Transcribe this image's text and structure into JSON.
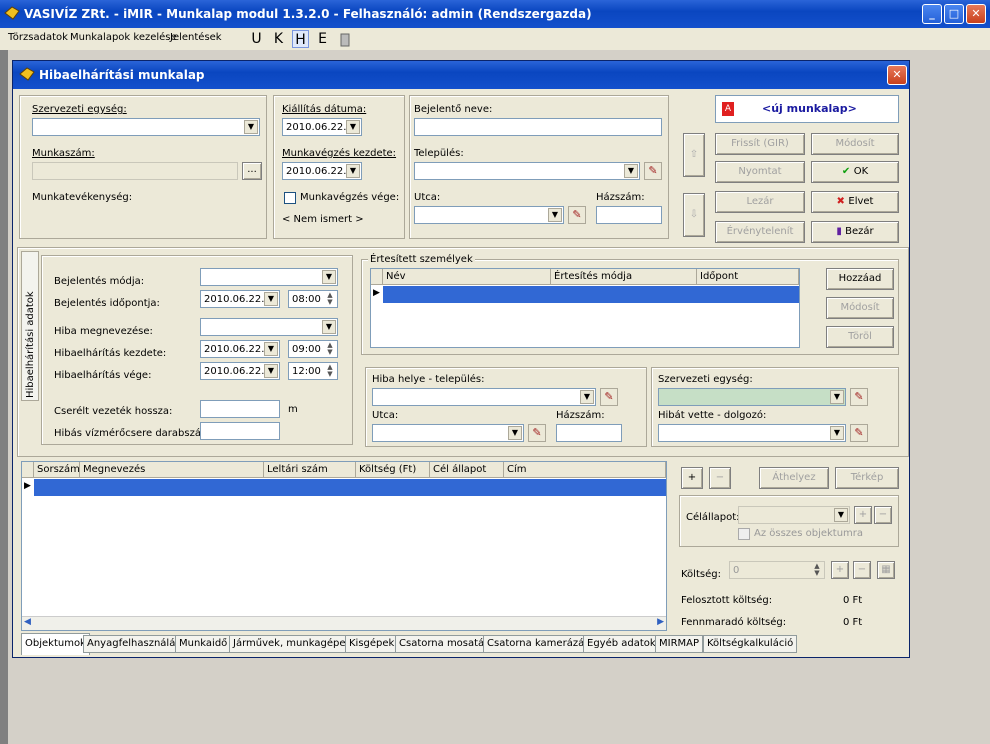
{
  "app": {
    "title": "VASIVÍZ ZRt. - iMIR - Munkalap modul 1.3.2.0 - Felhasználó: admin (Rendszergazda)",
    "min": "_",
    "max": "□",
    "close": "✕"
  },
  "menu": {
    "items": [
      "Törzsadatok",
      "Munkalapok kezelése",
      "Jelentések"
    ],
    "ukhe": [
      "U",
      "K",
      "H",
      "E"
    ]
  },
  "window": {
    "title": "Hibaelhárítási munkalap",
    "close": "✕"
  },
  "top": {
    "szervezeti_egyseg_label": "Szervezeti egység:",
    "munkaszam_label": "Munkaszám:",
    "browse": "...",
    "munkatevekenyseg_label": "Munkatevékenység:",
    "kiallitas_label": "Kiállítás dátuma:",
    "kiallitas_value": "2010.06.22.",
    "kezdete_label": "Munkavégzés kezdete:",
    "kezdete_value": "2010.06.22.",
    "vege_label": "Munkavégzés vége:",
    "nem_ismert": "< Nem ismert >",
    "bejelento_label": "Bejelentő neve:",
    "telepules_label": "Település:",
    "utca_label": "Utca:",
    "hazszam_label": "Házszám:"
  },
  "status": {
    "letter": "A",
    "text": "<új munkalap>"
  },
  "actions": {
    "frissit": "Frissít (GIR)",
    "modosit": "Módosít",
    "nyomtat": "Nyomtat",
    "ok": "OK",
    "lezar": "Lezár",
    "elvet": "Elvet",
    "ervenytelenit": "Érvénytelenít",
    "bezar": "Bezár"
  },
  "hiba": {
    "side_tab": "Hibaelhárítási adatok",
    "bejelentes_modja": "Bejelentés módja:",
    "bejelentes_idopontja": "Bejelentés időpontja:",
    "date1": "2010.06.22.",
    "time1": "08:00",
    "hiba_megnevezese": "Hiba megnevezése:",
    "kezdete": "Hibaelhárítás kezdete:",
    "date2": "2010.06.22.",
    "time2": "09:00",
    "vege": "Hibaelhárítás vége:",
    "date3": "2010.06.22.",
    "time3": "12:00",
    "csere_label": "Cserélt vezeték hossza:",
    "unit_m": "m",
    "vizmero_label": "Hibás vízmérőcsere darabszám:"
  },
  "ertesitett": {
    "title": "Értesített személyek",
    "columns": [
      "Név",
      "Értesítés módja",
      "Időpont"
    ],
    "hozzaad": "Hozzáad",
    "modosit": "Módosít",
    "torol": "Töröl"
  },
  "hely": {
    "telepules_label": "Hiba helye - település:",
    "utca_label": "Utca:",
    "hazszam_label": "Házszám:",
    "szervezeti_label": "Szervezeti egység:",
    "hibat_vette_label": "Hibát vette - dolgozó:"
  },
  "objektumok": {
    "columns": [
      "Sorszám",
      "Megnevezés",
      "Leltári szám",
      "Költség (Ft)",
      "Cél állapot",
      "Cím"
    ],
    "plus": "+",
    "minus": "−",
    "athelyez": "Áthelyez",
    "terkep": "Térkép",
    "celallapot_label": "Célállapot:",
    "osszes_label": "Az összes objektumra",
    "koltseg_label": "Költség:",
    "koltseg_value": "0",
    "felosztott_label": "Felosztott költség:",
    "felosztott_value": "0 Ft",
    "fennmarado_label": "Fennmaradó költség:",
    "fennmarado_value": "0 Ft"
  },
  "tabs": [
    "Objektumok",
    "Anyagfelhasználás",
    "Munkaidő",
    "Járművek, munkagépek",
    "Kisgépek",
    "Csatorna mosatás",
    "Csatorna kamerázás",
    "Egyéb adatok",
    "MIRMAP",
    "Költségkalkuláció"
  ]
}
